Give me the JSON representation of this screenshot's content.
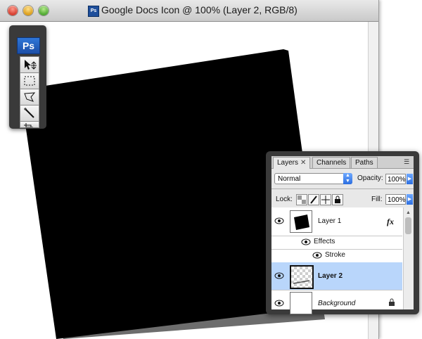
{
  "window": {
    "title": "Google Docs Icon @ 100% (Layer 2, RGB/8)",
    "doc_icon_text": "Ps"
  },
  "tools": {
    "logo": "Ps",
    "items": [
      "move-tool-icon",
      "marquee-tool-icon",
      "lasso-tool-icon",
      "magic-wand-tool-icon",
      "crop-tool-icon"
    ]
  },
  "layers_panel": {
    "tabs": [
      {
        "label": "Layers",
        "active": true
      },
      {
        "label": "Channels",
        "active": false
      },
      {
        "label": "Paths",
        "active": false
      }
    ],
    "blend_mode": "Normal",
    "opacity_label": "Opacity:",
    "opacity_value": "100%",
    "lock_label": "Lock:",
    "fill_label": "Fill:",
    "fill_value": "100%",
    "layers": [
      {
        "name": "Layer 1",
        "fx": "fx",
        "effects_label": "Effects",
        "effect_items": [
          "Stroke"
        ]
      },
      {
        "name": "Layer 2",
        "selected": true
      },
      {
        "name": "Background",
        "locked": true
      }
    ]
  },
  "colors": {
    "selection": "#b9d6fb",
    "panel_dark": "#3a3a3a",
    "ps_blue": "#1c4ea6"
  }
}
